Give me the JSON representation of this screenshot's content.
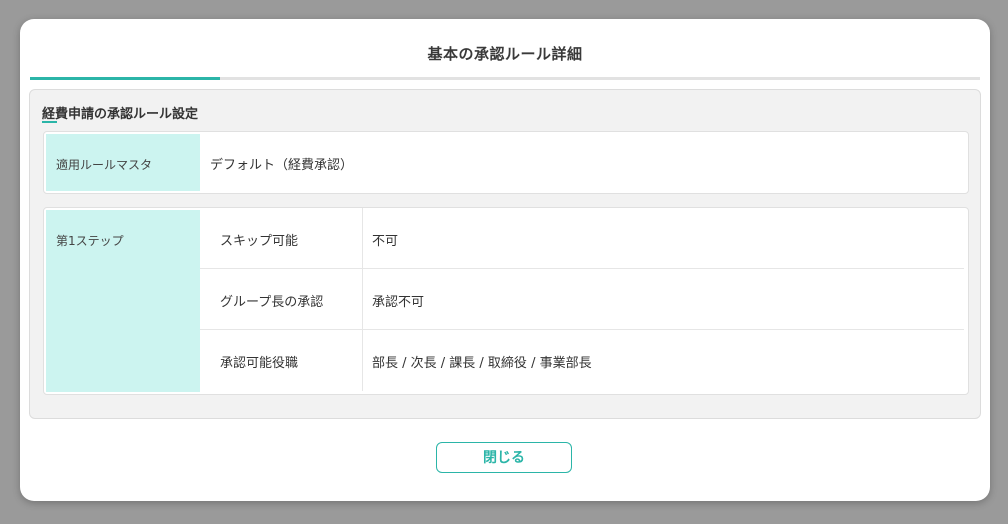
{
  "colors": {
    "accent": "#2bb5a8",
    "label_bg": "#ccf4f0"
  },
  "modal": {
    "title": "基本の承認ルール詳細"
  },
  "section": {
    "heading": "経費申請の承認ルール設定",
    "rule_master": {
      "label": "適用ルールマスタ",
      "value": "デフォルト（経費承認）"
    },
    "step1": {
      "label": "第1ステップ",
      "rows": [
        {
          "label": "スキップ可能",
          "value": "不可"
        },
        {
          "label": "グループ長の承認",
          "value": "承認不可"
        },
        {
          "label": "承認可能役職",
          "value": "部長 / 次長 / 課長 / 取締役 / 事業部長"
        }
      ]
    }
  },
  "footer": {
    "close_label": "閉じる"
  }
}
